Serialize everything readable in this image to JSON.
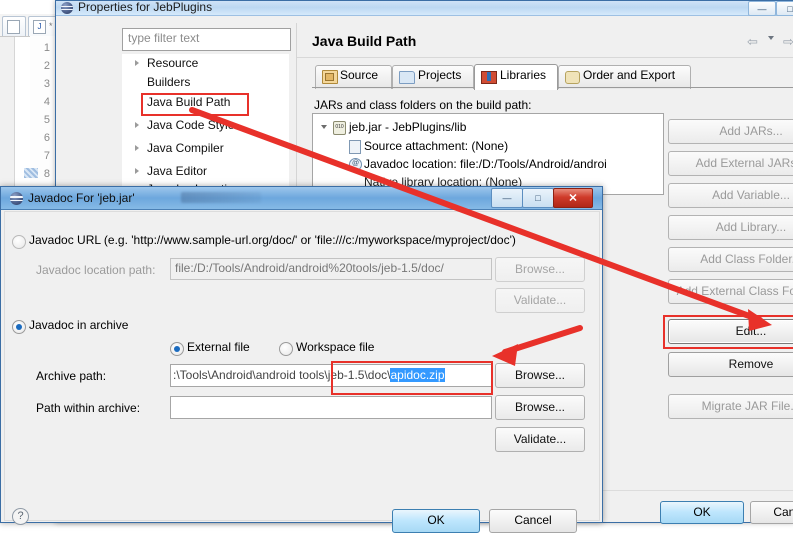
{
  "background_editor": {
    "line_numbers": [
      "1",
      "2",
      "3",
      "4",
      "5",
      "6",
      "7",
      "8"
    ],
    "tab_icon": "J"
  },
  "properties_dialog": {
    "title": "Properties for JebPlugins",
    "window_buttons": [
      {
        "name": "minimize",
        "glyph": "—"
      },
      {
        "name": "maximize",
        "glyph": "□"
      },
      {
        "name": "close",
        "glyph": "✕"
      }
    ],
    "filter": {
      "placeholder": "type filter text",
      "value": ""
    },
    "tree_items": [
      {
        "label": "Resource",
        "expandable": true,
        "selected": false
      },
      {
        "label": "Builders",
        "expandable": false,
        "selected": false
      },
      {
        "label": "Java Build Path",
        "expandable": false,
        "selected": true
      },
      {
        "label": "Java Code Style",
        "expandable": true,
        "selected": false
      },
      {
        "label": "Java Compiler",
        "expandable": true,
        "selected": false
      },
      {
        "label": "Java Editor",
        "expandable": true,
        "selected": false
      },
      {
        "label": "Javadoc Location",
        "expandable": false,
        "selected": false
      }
    ],
    "page_title": "Java Build Path",
    "nav": {
      "back": "⇦",
      "forward": "⇨",
      "menu": "▼"
    },
    "tabs": [
      {
        "label": "Source",
        "icon": "source-folder-icon",
        "active": false
      },
      {
        "label": "Projects",
        "icon": "projects-folder-icon",
        "active": false
      },
      {
        "label": "Libraries",
        "icon": "libraries-books-icon",
        "active": true
      },
      {
        "label": "Order and Export",
        "icon": "order-export-icon",
        "active": false
      }
    ],
    "jars_label": "JARs and class folders on the build path:",
    "tree_rows": [
      {
        "label": "jeb.jar - JebPlugins/lib",
        "icon": "jar-icon",
        "indent": 0,
        "expanded": true
      },
      {
        "label": "Source attachment: (None)",
        "icon": "source-attachment-icon",
        "indent": 1
      },
      {
        "label": "Javadoc location: file:/D:/Tools/Android/androi",
        "icon": "javadoc-icon",
        "indent": 1
      },
      {
        "label": "Native library location: (None)",
        "icon": "native-library-icon",
        "indent": 1
      }
    ],
    "buttons": [
      {
        "label": "Add JARs...",
        "enabled": false
      },
      {
        "label": "Add External JARs...",
        "enabled": false
      },
      {
        "label": "Add Variable...",
        "enabled": false
      },
      {
        "label": "Add Library...",
        "enabled": false
      },
      {
        "label": "Add Class Folder...",
        "enabled": false
      },
      {
        "label": "Add External Class Folder...",
        "enabled": false
      },
      {
        "label": "Edit...",
        "enabled": true,
        "highlighted": true
      },
      {
        "label": "Remove",
        "enabled": true
      },
      {
        "label": "Migrate JAR File...",
        "enabled": false
      }
    ],
    "ok_label": "OK",
    "cancel_label": "Cancel"
  },
  "javadoc_dialog": {
    "title": "Javadoc For 'jeb.jar'",
    "window_buttons": [
      {
        "name": "minimize",
        "glyph": "—"
      },
      {
        "name": "restore",
        "glyph": "□"
      },
      {
        "name": "close",
        "glyph": "✕"
      }
    ],
    "javadoc_url": {
      "radio_label": "Javadoc URL (e.g. 'http://www.sample-url.org/doc/' or 'file:///c:/myworkspace/myproject/doc')",
      "selected": false,
      "path_label": "Javadoc location path:",
      "path_value": "file:/D:/Tools/Android/android%20tools/jeb-1.5/doc/",
      "browse_label": "Browse...",
      "validate_label": "Validate..."
    },
    "javadoc_archive": {
      "radio_label": "Javadoc in archive",
      "selected": true,
      "file_source": [
        {
          "label": "External file",
          "selected": true
        },
        {
          "label": "Workspace file",
          "selected": false
        }
      ],
      "archive_path_label": "Archive path:",
      "archive_path_value_prefix": ":\\Tools\\Android\\android tools\\jeb-1.5\\doc\\",
      "archive_path_value_selected": "apidoc.zip",
      "archive_browse_label": "Browse...",
      "path_within_label": "Path within archive:",
      "path_within_value": "",
      "path_within_browse_label": "Browse...",
      "validate_label": "Validate..."
    },
    "help_glyph": "?",
    "ok_label": "OK",
    "cancel_label": "Cancel"
  },
  "annotations": {
    "highlight_color": "#e8312a",
    "arrow_color": "#e8312a",
    "boxes": [
      "java-build-path-tree-item",
      "edit-button",
      "archive-path-filename"
    ],
    "arrows": [
      "tree-to-edit-button",
      "edit-to-archive-path"
    ]
  }
}
